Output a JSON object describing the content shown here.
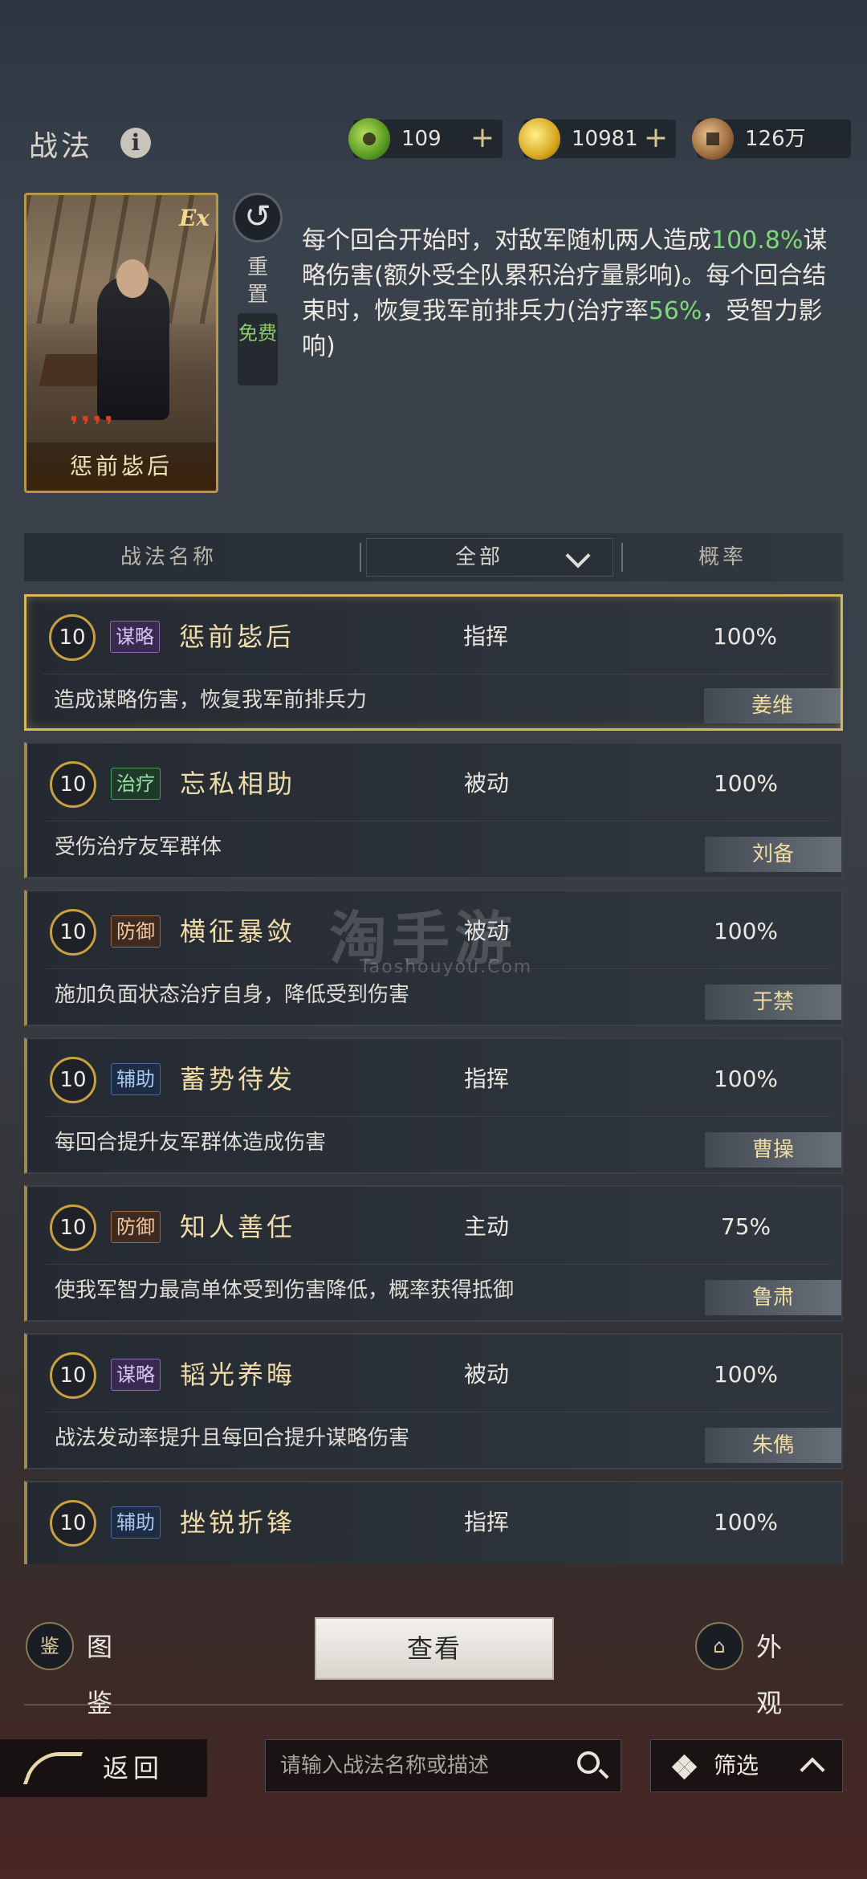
{
  "header": {
    "title": "战法",
    "resources": [
      {
        "icon": "jade-coin-icon",
        "value": "109",
        "has_plus": true
      },
      {
        "icon": "gold-coin-icon",
        "value": "10981",
        "has_plus": true
      },
      {
        "icon": "copper-coin-icon",
        "value": "126万",
        "has_plus": false
      }
    ]
  },
  "featured": {
    "card_badge": "Ex",
    "card_name": "惩前毖后",
    "reset_label": "重置",
    "free_label": "免费",
    "desc_parts": [
      "每个回合开始时，对敌军随机两人造成",
      "100.8%",
      "谋略伤害(额外受全队累积治疗量影响)。每个回合结束时，恢复我军前排兵力(治疗率",
      "56%",
      "，受智力影响)"
    ]
  },
  "table_header": {
    "name_col": "战法名称",
    "filter_value": "全部",
    "prob_col": "概率"
  },
  "skills": [
    {
      "level": "10",
      "tag": "谋略",
      "tag_type": "ml",
      "name": "惩前毖后",
      "type": "指挥",
      "prob": "100%",
      "desc": "造成谋略伤害，恢复我军前排兵力",
      "owner": "姜维",
      "selected": true
    },
    {
      "level": "10",
      "tag": "治疗",
      "tag_type": "zl",
      "name": "忘私相助",
      "type": "被动",
      "prob": "100%",
      "desc": "受伤治疗友军群体",
      "owner": "刘备",
      "selected": false
    },
    {
      "level": "10",
      "tag": "防御",
      "tag_type": "fy",
      "name": "横征暴敛",
      "type": "被动",
      "prob": "100%",
      "desc": "施加负面状态治疗自身，降低受到伤害",
      "owner": "于禁",
      "selected": false
    },
    {
      "level": "10",
      "tag": "辅助",
      "tag_type": "fz",
      "name": "蓄势待发",
      "type": "指挥",
      "prob": "100%",
      "desc": "每回合提升友军群体造成伤害",
      "owner": "曹操",
      "selected": false
    },
    {
      "level": "10",
      "tag": "防御",
      "tag_type": "fy",
      "name": "知人善任",
      "type": "主动",
      "prob": "75%",
      "desc": "使我军智力最高单体受到伤害降低，概率获得抵御",
      "owner": "鲁肃",
      "selected": false
    },
    {
      "level": "10",
      "tag": "谋略",
      "tag_type": "ml",
      "name": "韬光养晦",
      "type": "被动",
      "prob": "100%",
      "desc": "战法发动率提升且每回合提升谋略伤害",
      "owner": "朱儁",
      "selected": false
    },
    {
      "level": "10",
      "tag": "辅助",
      "tag_type": "fz",
      "name": "挫锐折锋",
      "type": "指挥",
      "prob": "100%",
      "desc": "",
      "owner": "",
      "selected": false
    }
  ],
  "watermark": {
    "main": "淘手游",
    "sub": "Taoshouyou.Com"
  },
  "actions": {
    "atlas_icon_glyph": "鉴",
    "atlas_label": "图鉴",
    "view_label": "查看",
    "appearance_label": "外观"
  },
  "bottom_bar": {
    "back_label": "返回",
    "search_placeholder": "请输入战法名称或描述",
    "filter_label": "筛选"
  }
}
